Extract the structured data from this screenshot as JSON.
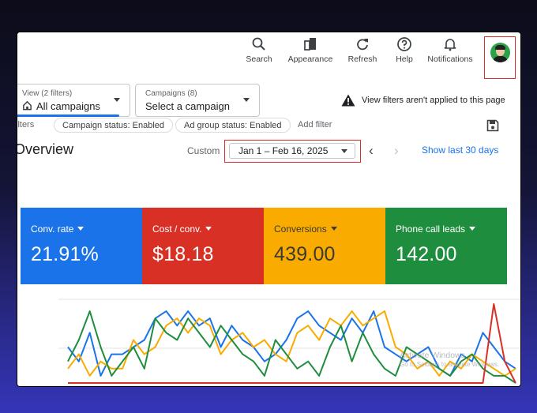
{
  "topbar": {
    "items": [
      {
        "label": "Search",
        "icon": "search-icon"
      },
      {
        "label": "Appearance",
        "icon": "appearance-icon"
      },
      {
        "label": "Refresh",
        "icon": "refresh-icon"
      },
      {
        "label": "Help",
        "icon": "help-icon"
      },
      {
        "label": "Notifications",
        "icon": "bell-icon"
      }
    ]
  },
  "view_filter": {
    "label": "View (2 filters)",
    "value": "All campaigns"
  },
  "campaign_filter": {
    "label": "Campaigns (8)",
    "value": "Select a campaign"
  },
  "warning": {
    "text": "View filters aren't applied to this page"
  },
  "filters": {
    "lead": "ilters",
    "chips": [
      "Campaign status: Enabled",
      "Ad group status: Enabled"
    ],
    "add_label": "Add filter"
  },
  "overview": {
    "title": "Overview",
    "custom_label": "Custom",
    "date_range": "Jan 1 – Feb 16, 2025",
    "prev": "‹",
    "next": "›",
    "show_last": "Show last 30 days"
  },
  "metrics": [
    {
      "title": "Conv. rate",
      "value": "21.91%",
      "color": "#1a73e8"
    },
    {
      "title": "Cost / conv.",
      "value": "$18.18",
      "color": "#d93025"
    },
    {
      "title": "Conversions",
      "value": "439.00",
      "color": "#f9ab00"
    },
    {
      "title": "Phone call leads",
      "value": "142.00",
      "color": "#1e8e3e"
    }
  ],
  "chart_data": {
    "type": "line",
    "series": [
      {
        "color": "#1a73e8",
        "values": [
          5,
          3,
          7,
          1,
          4,
          4,
          5,
          6,
          9,
          10,
          8,
          10,
          8,
          9,
          5,
          8,
          6,
          5,
          3,
          4,
          6,
          9,
          10,
          8,
          7,
          6,
          9,
          7,
          10,
          5,
          4,
          3,
          4,
          5,
          2,
          1,
          4,
          3,
          7,
          5,
          3,
          2
        ]
      },
      {
        "color": "#f9ab00",
        "values": [
          2,
          4,
          1,
          3,
          2,
          2,
          6,
          4,
          5,
          8,
          9,
          7,
          9,
          8,
          4,
          6,
          7,
          5,
          6,
          4,
          3,
          7,
          8,
          6,
          9,
          8,
          10,
          8,
          9,
          10,
          5,
          4,
          2,
          3,
          1,
          3,
          2,
          4,
          3,
          2,
          1,
          2
        ]
      },
      {
        "color": "#1e8e3e",
        "values": [
          3,
          6,
          10,
          5,
          1,
          3,
          5,
          2,
          9,
          7,
          6,
          9,
          7,
          5,
          8,
          6,
          4,
          3,
          1,
          6,
          4,
          2,
          3,
          1,
          5,
          8,
          3,
          7,
          4,
          2,
          1,
          5,
          4,
          3,
          2,
          1,
          3,
          4,
          2,
          1,
          1,
          0
        ]
      },
      {
        "color": "#d93025",
        "values": [
          0,
          0,
          0,
          0,
          0,
          0,
          0,
          0,
          0,
          0,
          0,
          0,
          0,
          0,
          0,
          0,
          0,
          0,
          0,
          0,
          0,
          0,
          0,
          0,
          0,
          0,
          0,
          0,
          0,
          0,
          0,
          0,
          0,
          0,
          0,
          0,
          0,
          0,
          0,
          11,
          3,
          0
        ]
      }
    ]
  },
  "watermark": {
    "line1": "Activate Windows",
    "line2": "Go to Settings to activate Windows."
  }
}
